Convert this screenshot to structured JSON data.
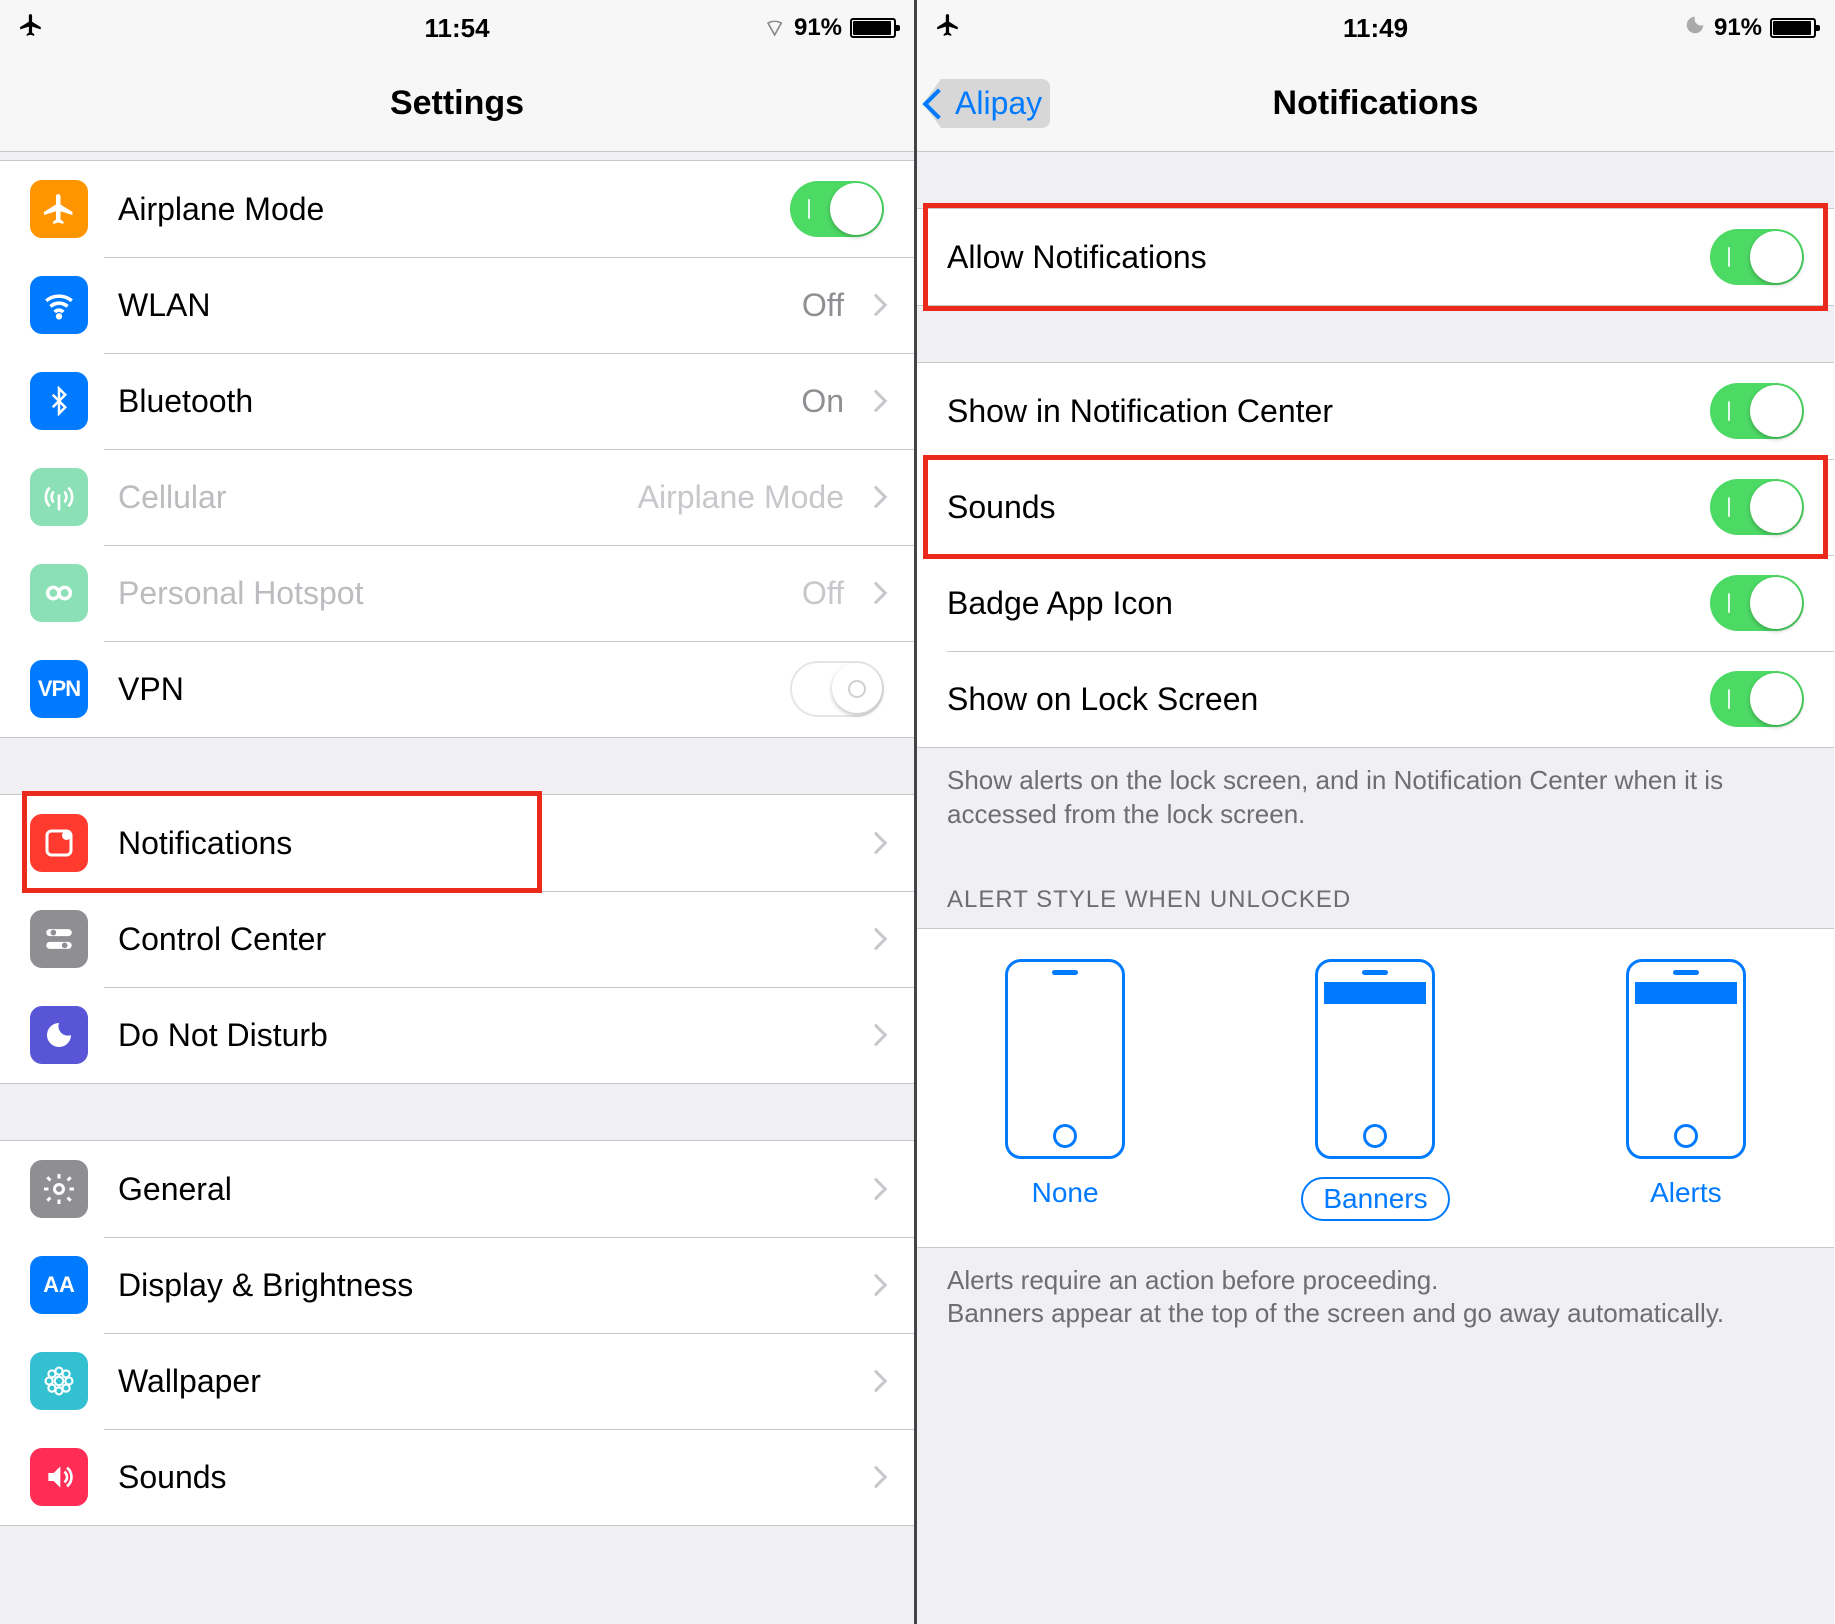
{
  "left": {
    "status": {
      "time": "11:54",
      "battery": "91%",
      "battery_fill": "91%",
      "bt": true
    },
    "nav": {
      "title": "Settings"
    },
    "g1": [
      {
        "id": "airplane",
        "label": "Airplane Mode",
        "toggle": true,
        "icon": "air"
      },
      {
        "id": "wlan",
        "label": "WLAN",
        "detail": "Off",
        "chev": true,
        "icon": "wifi"
      },
      {
        "id": "bluetooth",
        "label": "Bluetooth",
        "detail": "On",
        "chev": true,
        "icon": "bt"
      },
      {
        "id": "cellular",
        "label": "Cellular",
        "detail": "Airplane Mode",
        "chev": true,
        "icon": "cell",
        "dim": true
      },
      {
        "id": "hotspot",
        "label": "Personal Hotspot",
        "detail": "Off",
        "chev": true,
        "icon": "hot",
        "dim": true
      },
      {
        "id": "vpn",
        "label": "VPN",
        "toggle": false,
        "icon": "vpn",
        "vpn_text": "VPN"
      }
    ],
    "g2": [
      {
        "id": "notifications",
        "label": "Notifications",
        "chev": true,
        "icon": "notif",
        "highlight": true
      },
      {
        "id": "controlcenter",
        "label": "Control Center",
        "chev": true,
        "icon": "cc"
      },
      {
        "id": "dnd",
        "label": "Do Not Disturb",
        "chev": true,
        "icon": "dnd"
      }
    ],
    "g3": [
      {
        "id": "general",
        "label": "General",
        "chev": true,
        "icon": "gen"
      },
      {
        "id": "display",
        "label": "Display & Brightness",
        "chev": true,
        "icon": "disp",
        "disp_text": "AA"
      },
      {
        "id": "wallpaper",
        "label": "Wallpaper",
        "chev": true,
        "icon": "wall"
      },
      {
        "id": "sounds",
        "label": "Sounds",
        "chev": true,
        "icon": "snd"
      }
    ]
  },
  "right": {
    "status": {
      "time": "11:49",
      "battery": "91%",
      "battery_fill": "91%",
      "moon": true
    },
    "nav": {
      "title": "Notifications",
      "back": "Alipay"
    },
    "g1": [
      {
        "id": "allow",
        "label": "Allow Notifications",
        "toggle": true,
        "highlight": true
      }
    ],
    "g2": [
      {
        "id": "nic",
        "label": "Show in Notification Center",
        "toggle": true
      },
      {
        "id": "sounds",
        "label": "Sounds",
        "toggle": true,
        "highlight": true
      },
      {
        "id": "badge",
        "label": "Badge App Icon",
        "toggle": true
      },
      {
        "id": "lock",
        "label": "Show on Lock Screen",
        "toggle": true
      }
    ],
    "footer1": "Show alerts on the lock screen, and in Notification Center when it is accessed from the lock screen.",
    "alert_header": "ALERT STYLE WHEN UNLOCKED",
    "styles": [
      {
        "id": "none",
        "label": "None"
      },
      {
        "id": "banners",
        "label": "Banners",
        "selected": true,
        "bar": true
      },
      {
        "id": "alerts",
        "label": "Alerts",
        "bar": true
      }
    ],
    "footer2": "Alerts require an action before proceeding.\nBanners appear at the top of the screen and go away automatically."
  }
}
